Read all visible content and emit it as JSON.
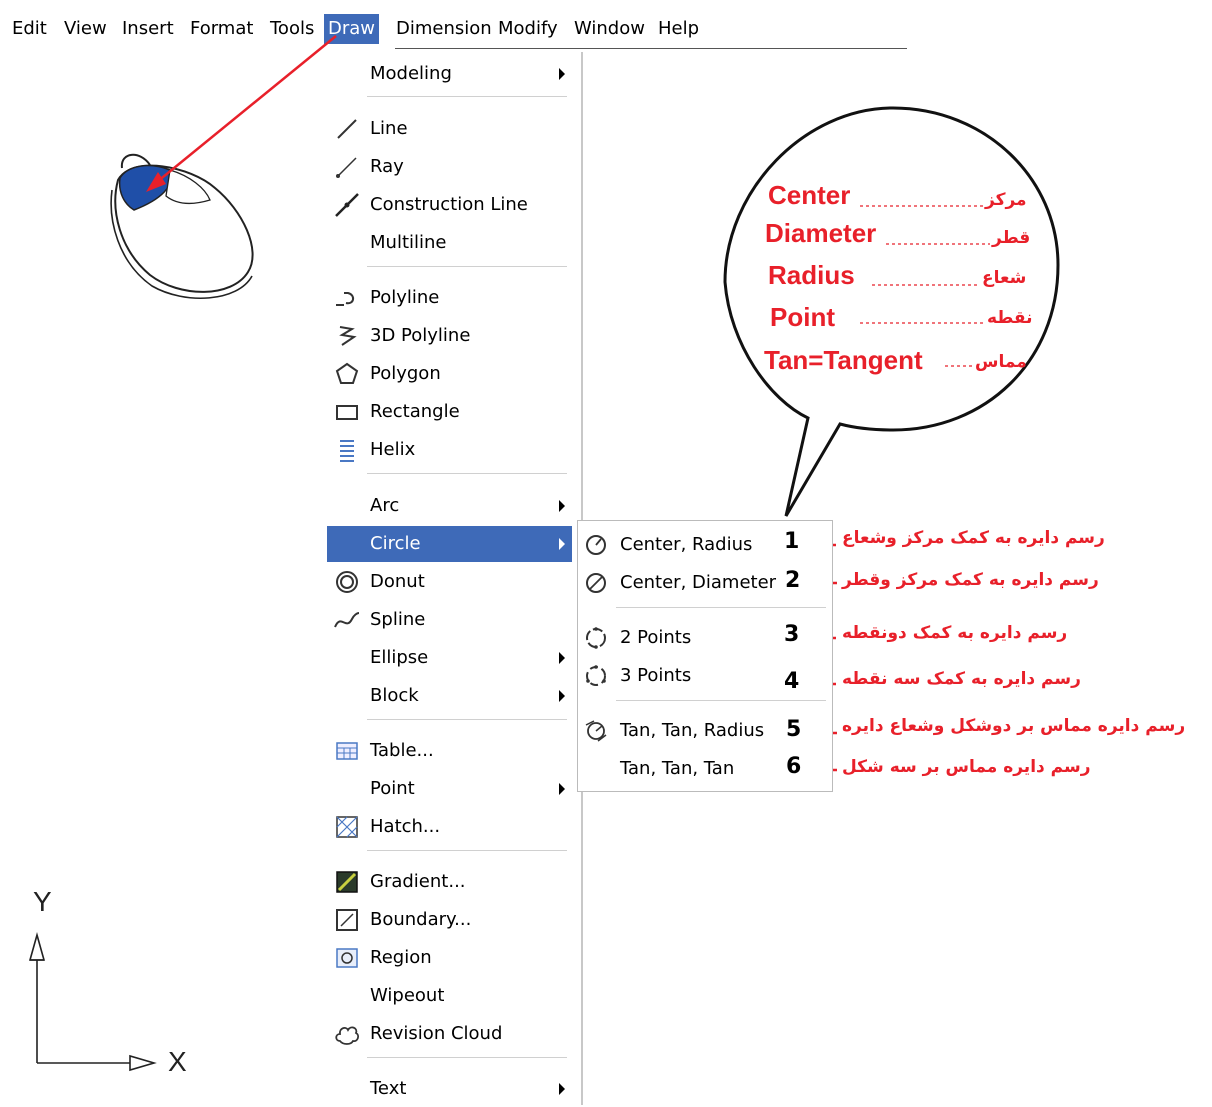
{
  "menubar": {
    "items": [
      "Edit",
      "View",
      "Insert",
      "Format",
      "Tools",
      "Draw",
      "Dimension",
      "Modify",
      "Window",
      "Help"
    ],
    "active_index": 5
  },
  "draw_menu": {
    "items": [
      {
        "label": "Modeling",
        "icon": "",
        "submenu": true
      },
      {
        "label": "Line",
        "icon": "line-icon",
        "submenu": false
      },
      {
        "label": "Ray",
        "icon": "ray-icon",
        "submenu": false
      },
      {
        "label": "Construction Line",
        "icon": "construction-line-icon",
        "submenu": false
      },
      {
        "label": "Multiline",
        "icon": "",
        "submenu": false
      },
      {
        "label": "Polyline",
        "icon": "polyline-icon",
        "submenu": false
      },
      {
        "label": "3D Polyline",
        "icon": "3d-polyline-icon",
        "submenu": false
      },
      {
        "label": "Polygon",
        "icon": "polygon-icon",
        "submenu": false
      },
      {
        "label": "Rectangle",
        "icon": "rectangle-icon",
        "submenu": false
      },
      {
        "label": "Helix",
        "icon": "helix-icon",
        "submenu": false
      },
      {
        "label": "Arc",
        "icon": "",
        "submenu": true
      },
      {
        "label": "Circle",
        "icon": "",
        "submenu": true,
        "highlighted": true
      },
      {
        "label": "Donut",
        "icon": "donut-icon",
        "submenu": false
      },
      {
        "label": "Spline",
        "icon": "spline-icon",
        "submenu": false
      },
      {
        "label": "Ellipse",
        "icon": "",
        "submenu": true
      },
      {
        "label": "Block",
        "icon": "",
        "submenu": true
      },
      {
        "label": "Table...",
        "icon": "table-icon",
        "submenu": false
      },
      {
        "label": "Point",
        "icon": "",
        "submenu": true
      },
      {
        "label": "Hatch...",
        "icon": "hatch-icon",
        "submenu": false
      },
      {
        "label": "Gradient...",
        "icon": "gradient-icon",
        "submenu": false
      },
      {
        "label": "Boundary...",
        "icon": "boundary-icon",
        "submenu": false
      },
      {
        "label": "Region",
        "icon": "region-icon",
        "submenu": false
      },
      {
        "label": "Wipeout",
        "icon": "",
        "submenu": false
      },
      {
        "label": "Revision Cloud",
        "icon": "revision-cloud-icon",
        "submenu": false
      },
      {
        "label": "Text",
        "icon": "",
        "submenu": true
      }
    ]
  },
  "circle_submenu": {
    "items": [
      {
        "label": "Center, Radius",
        "icon": "circle-center-radius-icon",
        "number": "1",
        "note": "رسم دایره به کمک مرکز وشعاع"
      },
      {
        "label": "Center, Diameter",
        "icon": "circle-center-diameter-icon",
        "number": "2",
        "note": "رسم دایره به کمک مرکز وقطر"
      },
      {
        "label": "2 Points",
        "icon": "circle-2-points-icon",
        "number": "3",
        "note": "رسم دایره به کمک دونقطه"
      },
      {
        "label": "3 Points",
        "icon": "circle-3-points-icon",
        "number": "4",
        "note": "رسم دایره به کمک سه نقطه"
      },
      {
        "label": "Tan, Tan, Radius",
        "icon": "circle-tan-tan-radius-icon",
        "number": "5",
        "note": "رسم دایره مماس بر دوشکل وشعاع دایره"
      },
      {
        "label": "Tan, Tan, Tan",
        "icon": "",
        "number": "6",
        "note": "رسم دایره مماس بر سه شکل"
      }
    ]
  },
  "bubble": {
    "rows": [
      {
        "en": "Center",
        "fa": "مرکز"
      },
      {
        "en": "Diameter",
        "fa": "قطر"
      },
      {
        "en": "Radius",
        "fa": "شعاع"
      },
      {
        "en": "Point",
        "fa": "نقطه"
      },
      {
        "en": "Tan=Tangent",
        "fa": "مماس"
      }
    ]
  },
  "ucs": {
    "x_label": "X",
    "y_label": "Y"
  },
  "colors": {
    "accent": "#3e6ab8",
    "annotation": "#e8202a",
    "mouse_button": "#1f4fa8"
  }
}
